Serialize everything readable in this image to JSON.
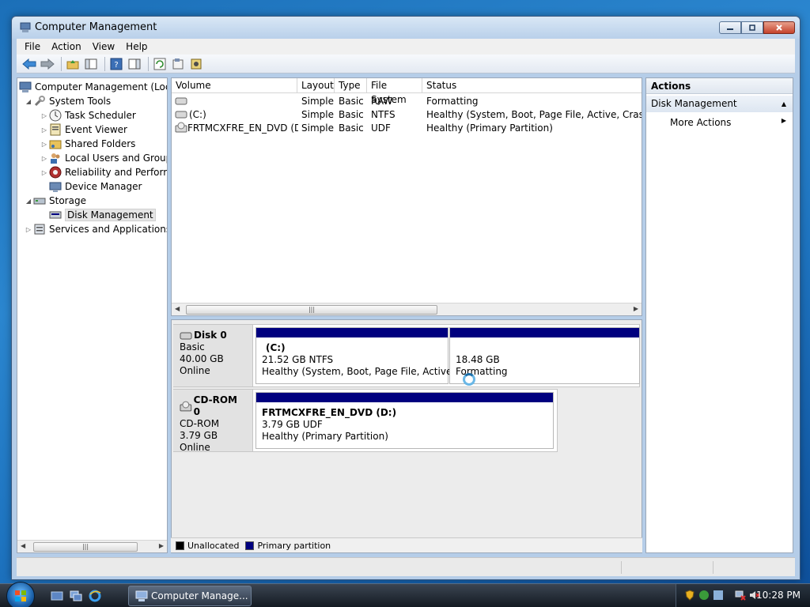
{
  "window": {
    "title": "Computer Management"
  },
  "menu": [
    "File",
    "Action",
    "View",
    "Help"
  ],
  "tree": {
    "root": "Computer Management (Local",
    "system_tools": "System Tools",
    "task_scheduler": "Task Scheduler",
    "event_viewer": "Event Viewer",
    "shared_folders": "Shared Folders",
    "local_users": "Local Users and Groups",
    "reliability": "Reliability and Performa",
    "device_manager": "Device Manager",
    "storage": "Storage",
    "disk_management": "Disk Management",
    "services": "Services and Applications"
  },
  "volumes": {
    "headers": [
      "Volume",
      "Layout",
      "Type",
      "File System",
      "Status"
    ],
    "rows": [
      [
        "",
        "Simple",
        "Basic",
        "RAW",
        "Formatting"
      ],
      [
        "(C:)",
        "Simple",
        "Basic",
        "NTFS",
        "Healthy (System, Boot, Page File, Active, Crash Dum"
      ],
      [
        "FRTMCXFRE_EN_DVD (D:)",
        "Simple",
        "Basic",
        "UDF",
        "Healthy (Primary Partition)"
      ]
    ]
  },
  "disks": [
    {
      "name": "Disk 0",
      "kind": "Basic",
      "size": "40.00 GB",
      "state": "Online",
      "partitions": [
        {
          "title": "(C:)",
          "size": "21.52 GB NTFS",
          "status": "Healthy (System, Boot, Page File, Active, Cra"
        },
        {
          "title": "",
          "size": "18.48 GB",
          "status": "Formatting"
        }
      ]
    },
    {
      "name": "CD-ROM 0",
      "kind": "CD-ROM",
      "size": "3.79 GB",
      "state": "Online",
      "partitions": [
        {
          "title": "FRTMCXFRE_EN_DVD  (D:)",
          "size": "3.79 GB UDF",
          "status": "Healthy (Primary Partition)"
        }
      ]
    }
  ],
  "legend": {
    "unallocated": "Unallocated",
    "primary": "Primary partition"
  },
  "actions": {
    "header": "Actions",
    "section": "Disk Management",
    "more": "More Actions"
  },
  "taskbar": {
    "task": "Computer Manage...",
    "clock": "10:28 PM"
  },
  "colors": {
    "primary_partition": "#00007f",
    "unallocated": "#000000"
  }
}
